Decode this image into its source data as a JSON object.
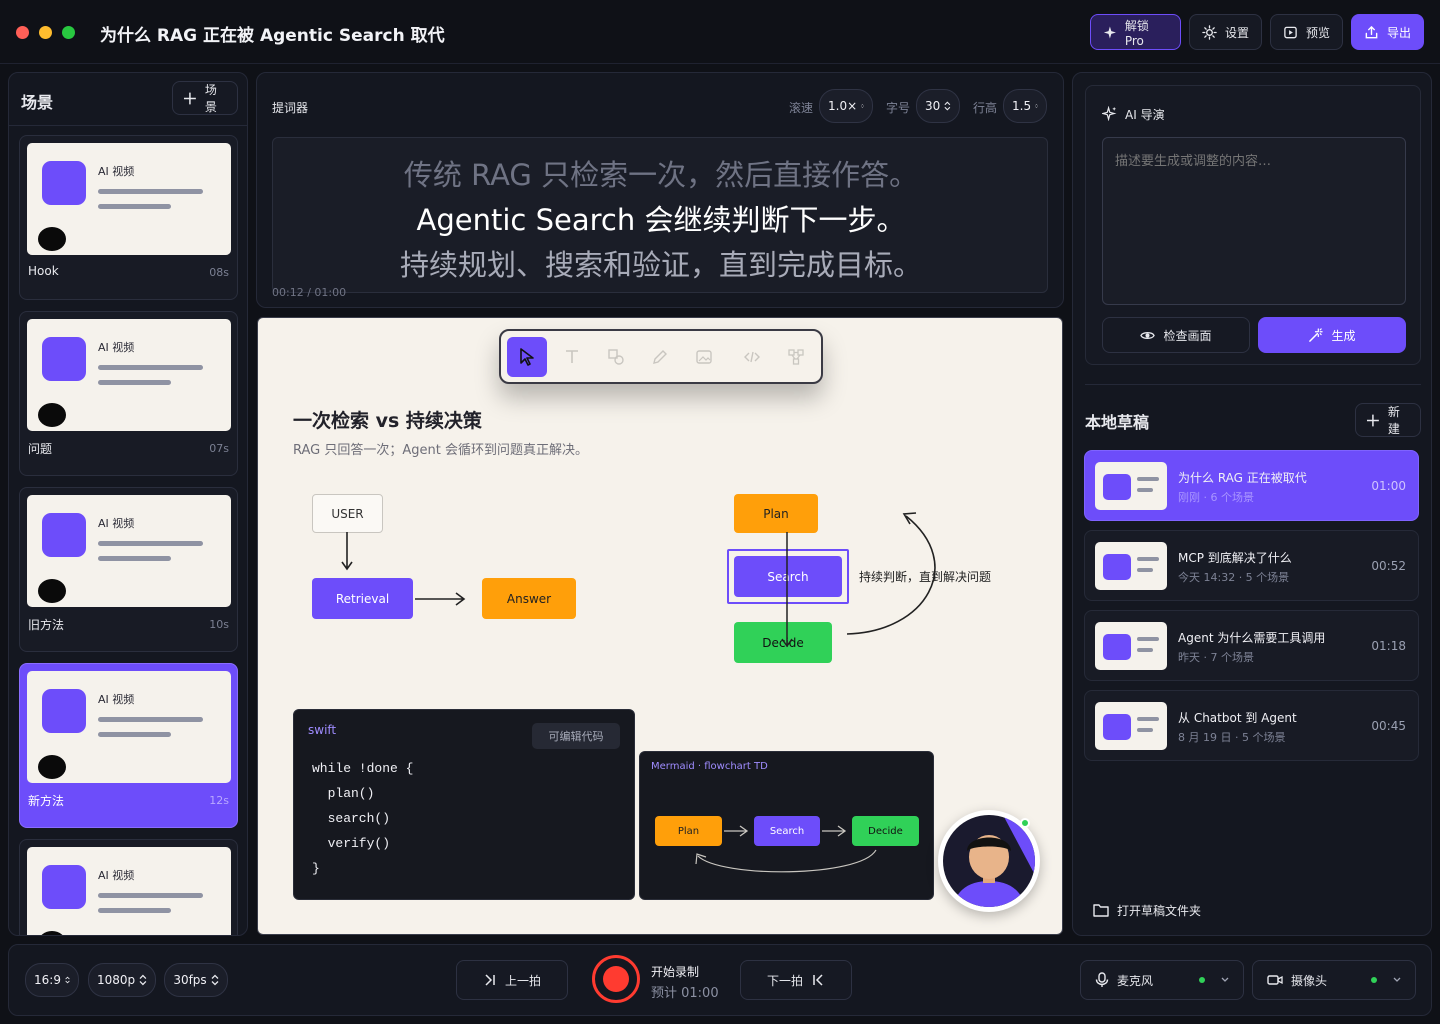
{
  "window": {
    "title": "为什么 RAG 正在被 Agentic Search 取代"
  },
  "toolbar": {
    "pro_label": "解锁 Pro",
    "settings_label": "设置",
    "preview_label": "预览",
    "export_label": "导出"
  },
  "scenes": {
    "title": "场景",
    "add_label": "场景",
    "items": [
      {
        "thumb_label": "AI 视频",
        "name": "Hook",
        "duration": "08s",
        "active": false
      },
      {
        "thumb_label": "AI 视频",
        "name": "问题",
        "duration": "07s",
        "active": false
      },
      {
        "thumb_label": "AI 视频",
        "name": "旧方法",
        "duration": "10s",
        "active": false
      },
      {
        "thumb_label": "AI 视频",
        "name": "新方法",
        "duration": "12s",
        "active": true
      },
      {
        "thumb_label": "AI 视频",
        "name": "",
        "duration": "",
        "active": false
      }
    ]
  },
  "prompter": {
    "title": "提词器",
    "speed_label": "滚速",
    "speed_value": "1.0×",
    "font_label": "字号",
    "font_value": "30",
    "line_label": "行高",
    "line_value": "1.5",
    "lines": [
      "传统 RAG 只检索一次，然后直接作答。",
      "Agentic Search 会继续判断下一步。",
      "持续规划、搜索和验证，直到完成目标。"
    ],
    "time": "00:12 / 01:00"
  },
  "canvas": {
    "heading": "一次检索 vs 持续决策",
    "subheading": "RAG 只回答一次；Agent 会循环到问题真正解决。",
    "rag": {
      "user": "USER",
      "retrieval": "Retrieval",
      "answer": "Answer"
    },
    "agent": {
      "plan": "Plan",
      "search": "Search",
      "decide": "Decide",
      "loop_label": "持续判断，直到解决问题"
    },
    "code": {
      "lang": "swift",
      "badge": "可编辑代码",
      "lines": [
        "while !done {",
        "  plan()",
        "  search()",
        "  verify()",
        "}"
      ]
    },
    "mermaid": {
      "header": "Mermaid · flowchart TD",
      "nodes": [
        "Plan",
        "Search",
        "Decide"
      ]
    },
    "tools": [
      "cursor-icon",
      "text-icon",
      "shapes-icon",
      "pen-icon",
      "image-icon",
      "code-icon",
      "diagram-icon"
    ]
  },
  "ai": {
    "title": "AI 导演",
    "placeholder": "描述要生成或调整的内容…",
    "inspect_label": "检查画面",
    "generate_label": "生成"
  },
  "drafts": {
    "title": "本地草稿",
    "new_label": "新建",
    "items": [
      {
        "title": "为什么 RAG 正在被取代",
        "meta": "刚刚 · 6 个场景",
        "duration": "01:00",
        "active": true
      },
      {
        "title": "MCP 到底解决了什么",
        "meta": "今天 14:32 · 5 个场景",
        "duration": "00:52",
        "active": false
      },
      {
        "title": "Agent 为什么需要工具调用",
        "meta": "昨天 · 7 个场景",
        "duration": "01:18",
        "active": false
      },
      {
        "title": "从 Chatbot 到 Agent",
        "meta": "8 月 19 日 · 5 个场景",
        "duration": "00:45",
        "active": false
      }
    ],
    "open_folder_label": "打开草稿文件夹"
  },
  "bottom": {
    "aspect": "16:9",
    "resolution": "1080p",
    "fps": "30fps",
    "prev_label": "上一拍",
    "record_label": "开始录制",
    "record_estimate": "预计 01:00",
    "next_label": "下一拍",
    "mic_label": "麦克风",
    "camera_label": "摄像头"
  },
  "colors": {
    "accent": "#6d4dfa",
    "orange": "#ff9f0a",
    "green": "#30d158",
    "record": "#ff3b30"
  }
}
